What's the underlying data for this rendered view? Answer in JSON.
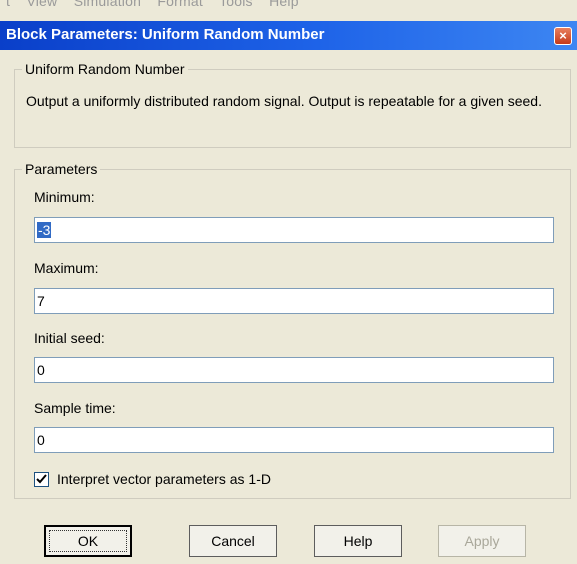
{
  "menubar": {
    "visible_text": "t    View    Simulation    Format    Tools    Help"
  },
  "window": {
    "title": "Block Parameters: Uniform Random Number",
    "close_icon": "x-glyph"
  },
  "block_group": {
    "legend": "Uniform Random Number",
    "description": "Output a uniformly distributed random signal.  Output is repeatable for a given seed."
  },
  "parameters_group": {
    "legend": "Parameters",
    "minimum": {
      "label": "Minimum:",
      "value": "-3"
    },
    "maximum": {
      "label": "Maximum:",
      "value": "7"
    },
    "initial_seed": {
      "label": "Initial seed:",
      "value": "0"
    },
    "sample_time": {
      "label": "Sample time:",
      "value": "0"
    },
    "interpret_vector": {
      "label": "Interpret vector parameters as 1-D",
      "checked": true
    }
  },
  "buttons": {
    "ok": "OK",
    "cancel": "Cancel",
    "help": "Help",
    "apply": "Apply"
  },
  "colors": {
    "title_bar": "#1e63e8",
    "dialog_bg": "#ece9d8",
    "selection": "#316ac5",
    "close_button": "#d2502e"
  }
}
